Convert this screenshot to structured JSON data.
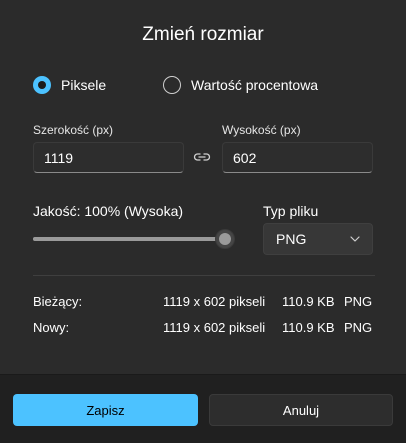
{
  "dialog": {
    "title": "Zmień rozmiar"
  },
  "mode": {
    "options": [
      {
        "label": "Piksele",
        "checked": true
      },
      {
        "label": "Wartość procentowa",
        "checked": false
      }
    ]
  },
  "size": {
    "width_label": "Szerokość (px)",
    "width_value": "1119",
    "height_label": "Wysokość (px)",
    "height_value": "602",
    "link_icon": "link-icon"
  },
  "quality": {
    "label": "Jakość: 100% (Wysoka)",
    "value_percent": 100
  },
  "file_type": {
    "label": "Typ pliku",
    "selected": "PNG",
    "icon": "chevron-down-icon"
  },
  "info": {
    "current": {
      "label": "Bieżący:",
      "dimensions": "1119 x 602 pikseli",
      "size": "110.9 KB",
      "format": "PNG"
    },
    "new": {
      "label": "Nowy:",
      "dimensions": "1119 x 602 pikseli",
      "size": "110.9 KB",
      "format": "PNG"
    }
  },
  "buttons": {
    "save_label": "Zapisz",
    "cancel_label": "Anuluj"
  },
  "colors": {
    "accent": "#4cc2ff",
    "background": "#2b2b2b",
    "footer": "#202020"
  }
}
